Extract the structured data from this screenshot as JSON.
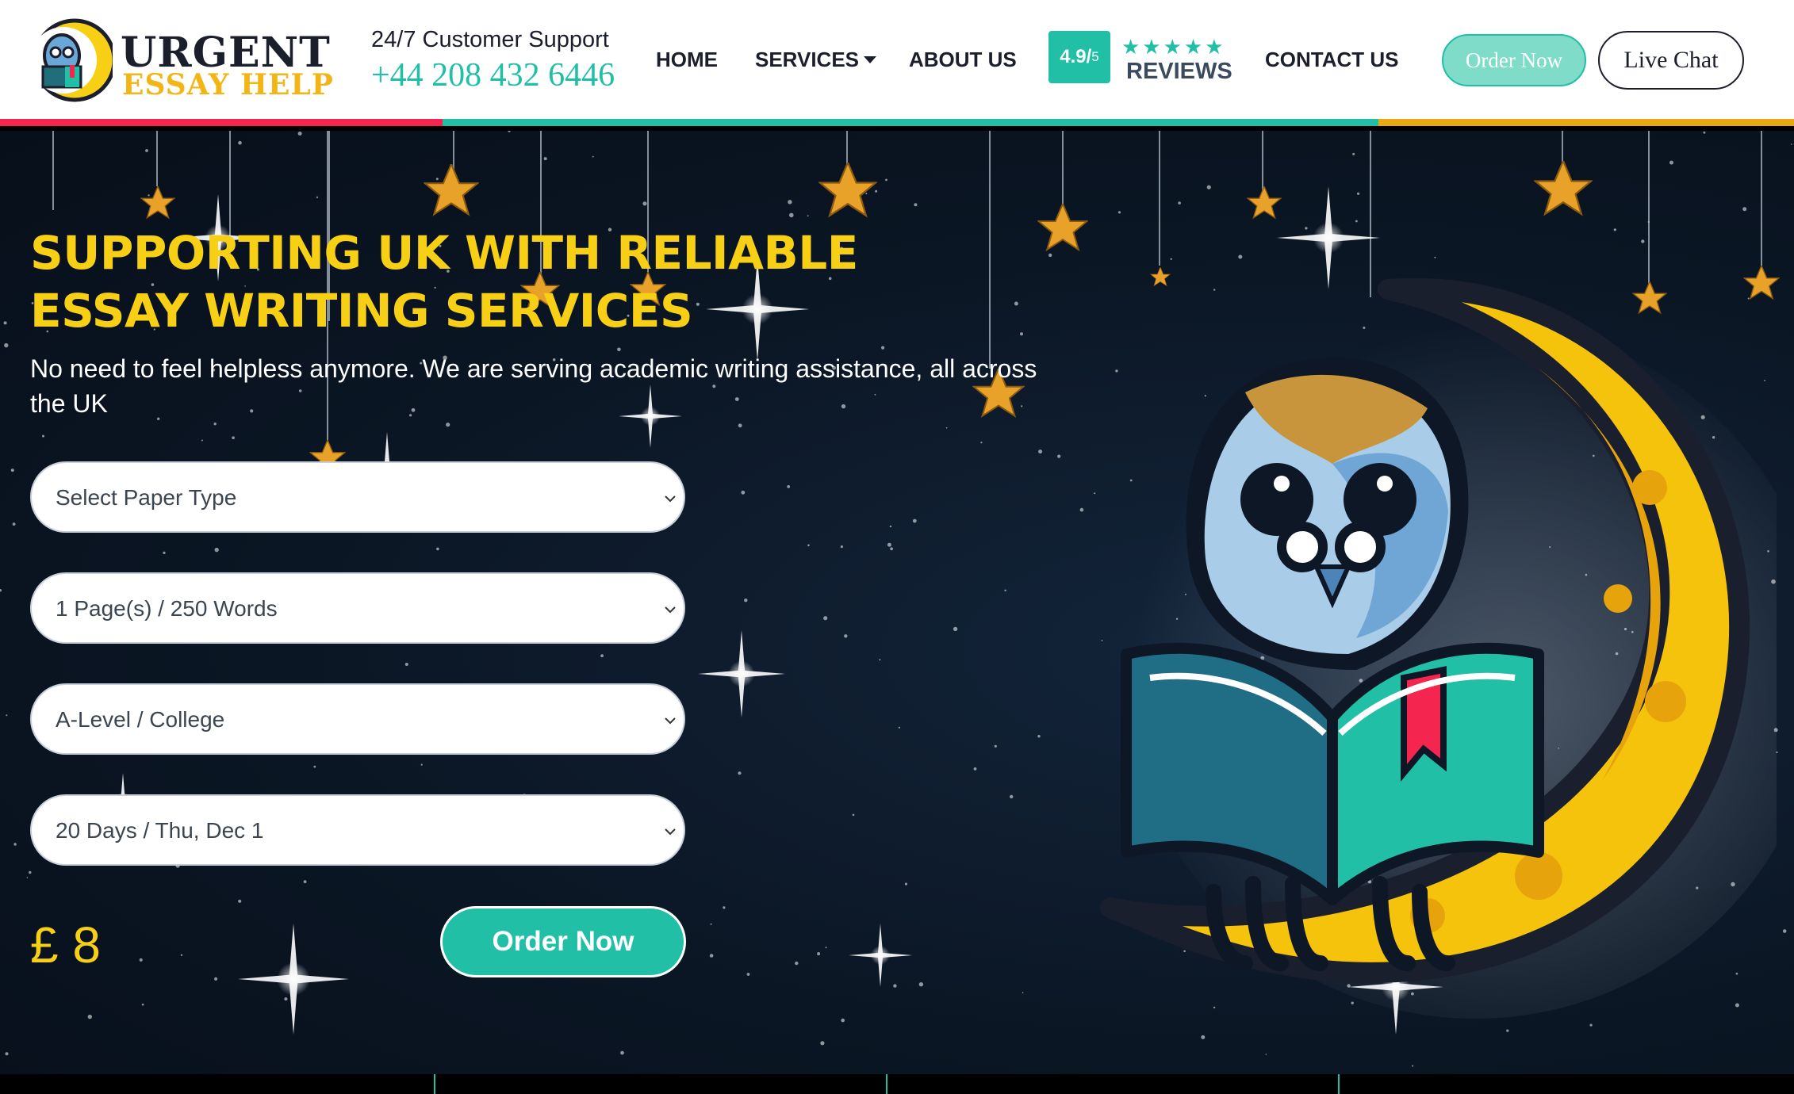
{
  "header": {
    "logo": {
      "line1": "URGENT",
      "line2": "ESSAY HELP"
    },
    "support": {
      "label": "24/7 Customer Support",
      "phone": "+44 208 432 6446"
    },
    "nav": {
      "home": "HOME",
      "services": "SERVICES",
      "about": "ABOUT US",
      "contact": "CONTACT US"
    },
    "rating": {
      "score": "4.9/",
      "out_of": "5",
      "stars": "★★★★★",
      "label": "REVIEWS"
    },
    "buttons": {
      "order_now": "Order Now",
      "live_chat": "Live Chat"
    }
  },
  "colors": {
    "teal": "#22bfa7",
    "gold": "#f7cf14",
    "red": "#f4254e",
    "navy": "#0b1624"
  },
  "hero": {
    "title": "SUPPORTING UK WITH RELIABLE ESSAY WRITING SERVICES",
    "subtitle": "No need to feel helpless anymore. We are serving academic writing assistance, all across the UK",
    "form": {
      "paper_type": "Select Paper Type",
      "pages": "1 Page(s) / 250 Words",
      "level": "A-Level / College",
      "deadline": "20 Days / Thu, Dec 1"
    },
    "price": "£ 8",
    "order_button": "Order Now"
  },
  "icons": [
    "owl-logo-icon",
    "chevron-down-icon",
    "star-icon",
    "owl-on-moon-illustration"
  ]
}
